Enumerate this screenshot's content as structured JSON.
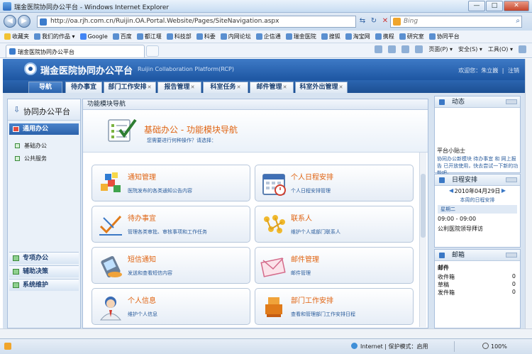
{
  "window": {
    "title": "瑞金医院协同办公平台 - Windows Internet Explorer",
    "buttons": [
      "—",
      "□",
      "✕"
    ]
  },
  "address_bar": {
    "url": "http://oa.rjh.com.cn/Ruijin.OA.Portal.Website/Pages/SiteNavigation.aspx",
    "search_placeholder": "Bing"
  },
  "favorites": [
    {
      "label": "收藏夹"
    },
    {
      "label": "我们的作品 ▾"
    },
    {
      "label": "Google"
    },
    {
      "label": "百度"
    },
    {
      "label": "都江堰"
    },
    {
      "label": "科技部"
    },
    {
      "label": "科委"
    },
    {
      "label": "内网论坛"
    },
    {
      "label": "企信通"
    },
    {
      "label": "瑞金医院"
    },
    {
      "label": "搜狐"
    },
    {
      "label": "淘宝网"
    },
    {
      "label": "携程"
    },
    {
      "label": "研究室"
    },
    {
      "label": "协同平台"
    }
  ],
  "browser_tab": {
    "label": "瑞金医院协同办公平台"
  },
  "command_bar": [
    "页面(P) ▾",
    "安全(S) ▾",
    "工具(O) ▾"
  ],
  "banner": {
    "system_name": "瑞金医院协同办公平台",
    "system_name_en": "Ruijin Collaboration Platform(RCP)",
    "welcome": "欢迎您：朱立巍",
    "logout": "注销"
  },
  "nav_tabs": [
    "导航",
    "待办事宜",
    "部门工作安排",
    "报告管理",
    "科室任务",
    "邮件管理",
    "科室外出管理"
  ],
  "sidebar": {
    "title": "协同办公平台",
    "group": "通用办公",
    "items": [
      "基础办公",
      "公共服务"
    ],
    "bottom_groups": [
      "专项办公",
      "辅助决策",
      "系统维护"
    ]
  },
  "main": {
    "panel_title": "功能模块导航",
    "heading": "基础办公 - 功能模块导航",
    "subheading": "您需要进行何种操作？请选择：",
    "cards": [
      {
        "title": "通知管理",
        "desc": "医院发布的各类通知公告内容"
      },
      {
        "title": "个人日程安排",
        "desc": "个人日程安排管理"
      },
      {
        "title": "待办事宜",
        "desc": "管理各类审批、审核事项和工作任务"
      },
      {
        "title": "联系人",
        "desc": "维护个人或部门联系人"
      },
      {
        "title": "短信通知",
        "desc": "发送和查看短信内容"
      },
      {
        "title": "邮件管理",
        "desc": "邮件管理"
      },
      {
        "title": "个人信息",
        "desc": "维护个人信息"
      },
      {
        "title": "部门工作安排",
        "desc": "查看和管理部门工作安排日程"
      }
    ]
  },
  "right": {
    "news": {
      "title": "动态",
      "tips_title": "平台小贴士",
      "tips_text": "协同办公新模块 待办事宜 和 网上报告 已开放使用，快去尝试一下新的功能吧。"
    },
    "schedule": {
      "title": "日程安排",
      "date": "2010年04月29日",
      "week_label": "本周的日程安排",
      "day": "星期二",
      "time": "09:00 - 09:00",
      "event": "公利医院领导拜访"
    },
    "mail": {
      "title": "邮箱",
      "subtitle": "邮件",
      "rows": [
        {
          "label": "收件箱",
          "count": "0"
        },
        {
          "label": "草稿",
          "count": "0"
        },
        {
          "label": "发件箱",
          "count": "0"
        }
      ]
    }
  },
  "status": {
    "zone": "Internet | 保护模式：启用",
    "zoom": "100%"
  }
}
